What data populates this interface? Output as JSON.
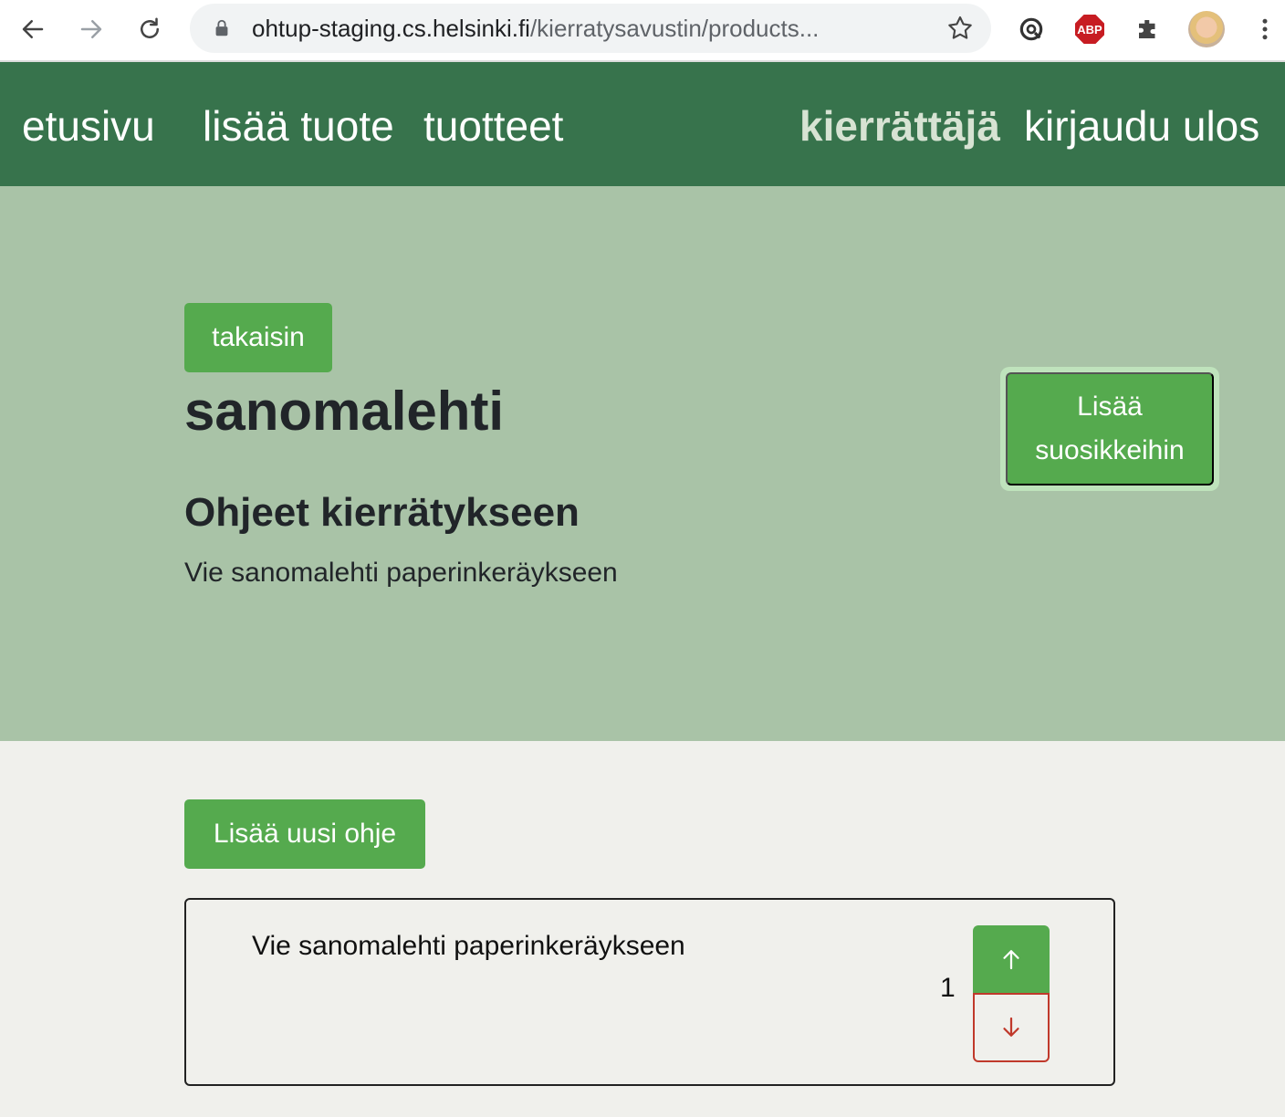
{
  "browser": {
    "url_host": "ohtup-staging.cs.helsinki.fi",
    "url_path": "/kierratysavustin/products...",
    "abp_label": "ABP",
    "icons": [
      "back-arrow-icon",
      "forward-arrow-icon",
      "reload-icon",
      "lock-icon",
      "star-icon",
      "sync-icon",
      "adblock-icon",
      "puzzle-icon",
      "profile-avatar",
      "kebab-menu-icon"
    ]
  },
  "navbar": {
    "home": "etusivu",
    "add_product": "lisää tuote",
    "products": "tuotteet",
    "user": "kierrättäjä",
    "logout": "kirjaudu ulos"
  },
  "product": {
    "back_label": "takaisin",
    "name": "sanomalehti",
    "instructions_heading": "Ohjeet kierrätykseen",
    "instruction_summary": "Vie sanomalehti paperinkeräykseen",
    "favorite_label": "Lisää suosikkeihin"
  },
  "instructions": {
    "add_label": "Lisää uusi ohje",
    "items": [
      {
        "text": "Vie sanomalehti paperinkeräykseen",
        "order": "1"
      }
    ]
  },
  "colors": {
    "navbar": "#37734c",
    "hero": "#a9c3a7",
    "button": "#55aa4e",
    "page": "#f0f0ec",
    "down_border": "#c0392b"
  }
}
